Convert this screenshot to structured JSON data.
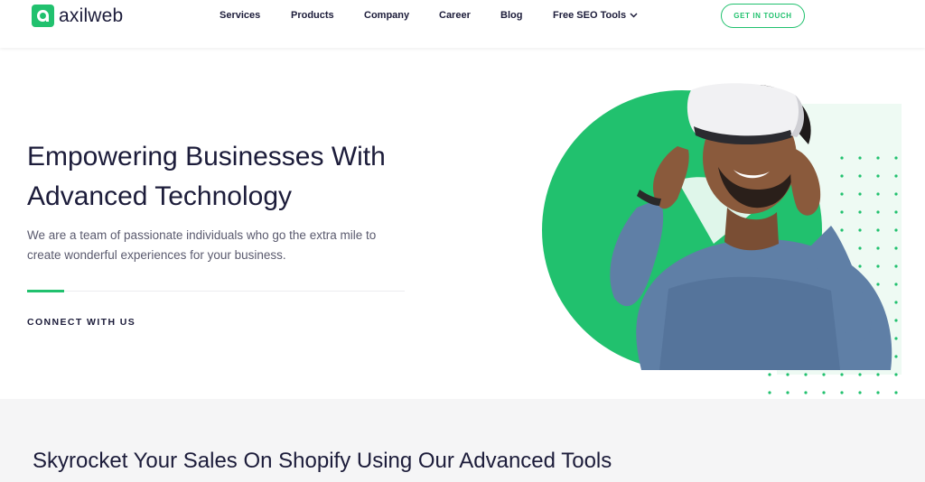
{
  "brand": {
    "name": "axilweb",
    "color": "#21c16e"
  },
  "nav": {
    "items": [
      {
        "label": "Services"
      },
      {
        "label": "Products"
      },
      {
        "label": "Company"
      },
      {
        "label": "Career"
      },
      {
        "label": "Blog"
      },
      {
        "label": "Free SEO Tools",
        "icon": "chevron-down-icon"
      }
    ],
    "cta_label": "GET IN TOUCH"
  },
  "hero": {
    "title_line1": "Empowering Businesses With",
    "title_line2": "Advanced Technology",
    "subtitle_line1": "We are a team of passionate individuals who go the extra mile to",
    "subtitle_line2": "create wonderful experiences for your business.",
    "connect_label": "CONNECT WITH US",
    "image_alt": "Man wearing a VR headset"
  },
  "section2": {
    "title": "Skyrocket Your Sales On Shopify Using Our Advanced Tools"
  }
}
